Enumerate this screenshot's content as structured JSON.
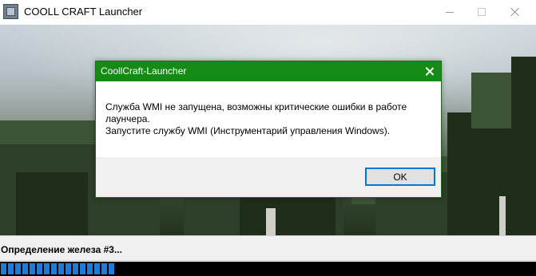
{
  "window": {
    "title": "COOLL CRAFT Launcher",
    "app_icon": "launcher-app-icon",
    "controls": {
      "minimize_icon": "minimize-icon",
      "maximize_icon": "maximize-icon",
      "close_icon": "close-icon"
    }
  },
  "status": {
    "text": "Определение железа #3...",
    "progress_color": "#1e7bd8",
    "progress_blocks": 16
  },
  "dialog": {
    "title": "CoollCraft-Launcher",
    "title_bar_color": "#158a15",
    "close_icon": "close-icon",
    "message_lines": [
      "Служба WMI не запущена, возможны критические ошибки в работе",
      "лаунчера.",
      "Запустите службу WMI (Инструментарий управления Windows)."
    ],
    "ok_label": "OK"
  }
}
